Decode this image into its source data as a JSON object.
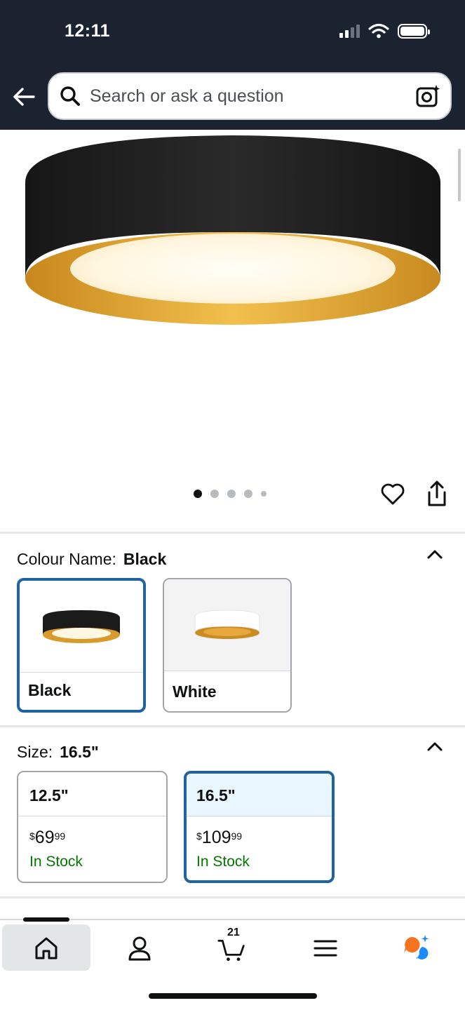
{
  "status_bar": {
    "time": "12:11"
  },
  "search": {
    "placeholder": "Search or ask a question"
  },
  "gallery": {
    "image_count": 5,
    "active_index": 0
  },
  "colour": {
    "label": "Colour Name:",
    "selected": "Black",
    "options": [
      {
        "name": "Black",
        "selected": true
      },
      {
        "name": "White",
        "selected": false
      }
    ]
  },
  "size": {
    "label": "Size:",
    "selected": "16.5\"",
    "options": [
      {
        "name": "12.5\"",
        "currency": "$",
        "whole": "69",
        "fraction": "99",
        "stock": "In Stock",
        "selected": false
      },
      {
        "name": "16.5\"",
        "currency": "$",
        "whole": "109",
        "fraction": "99",
        "stock": "In Stock",
        "selected": true
      }
    ]
  },
  "bottom_nav": {
    "cart_count": "21",
    "active": "home"
  },
  "colors": {
    "header_bg": "#1b2330",
    "selected_border": "#2162a1",
    "in_stock": "#007600",
    "assistant_orange": "#f7741e",
    "assistant_blue": "#1a8cff"
  }
}
